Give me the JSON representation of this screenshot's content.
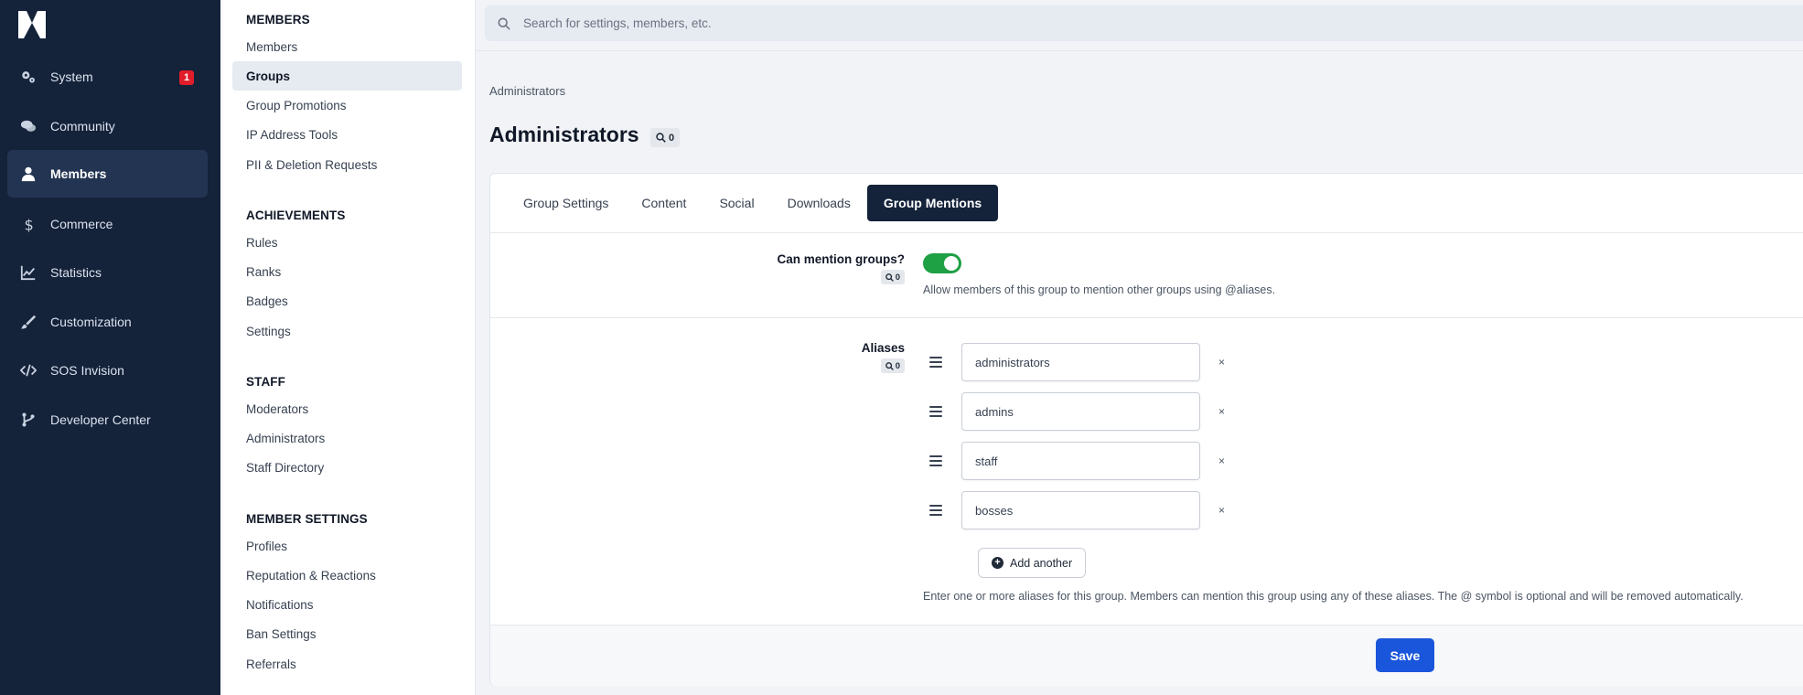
{
  "nav": {
    "logo_icon": "invision-logo",
    "items": [
      {
        "label": "System",
        "icon": "gears-icon",
        "badge": "1"
      },
      {
        "label": "Community",
        "icon": "chat-icon"
      },
      {
        "label": "Members",
        "icon": "user-icon",
        "active": true
      },
      {
        "label": "Commerce",
        "icon": "dollar-icon"
      },
      {
        "label": "Statistics",
        "icon": "chart-line-icon"
      },
      {
        "label": "Customization",
        "icon": "brush-icon"
      },
      {
        "label": "SOS Invision",
        "icon": "code-icon"
      },
      {
        "label": "Developer Center",
        "icon": "branch-icon"
      }
    ]
  },
  "submenu": {
    "sections": [
      {
        "heading": "MEMBERS",
        "items": [
          "Members",
          "Groups",
          "Group Promotions",
          "IP Address Tools",
          "PII & Deletion Requests"
        ]
      },
      {
        "heading": "ACHIEVEMENTS",
        "items": [
          "Rules",
          "Ranks",
          "Badges",
          "Settings"
        ]
      },
      {
        "heading": "STAFF",
        "items": [
          "Moderators",
          "Administrators",
          "Staff Directory"
        ]
      },
      {
        "heading": "MEMBER SETTINGS",
        "items": [
          "Profiles",
          "Reputation & Reactions",
          "Notifications",
          "Ban Settings",
          "Referrals"
        ]
      }
    ],
    "active_item": "Groups"
  },
  "search": {
    "placeholder": "Search for settings, members, etc."
  },
  "breadcrumb": "Administrators",
  "page": {
    "title": "Administrators",
    "search_count": "0"
  },
  "tabs": [
    "Group Settings",
    "Content",
    "Social",
    "Downloads",
    "Group Mentions"
  ],
  "active_tab": "Group Mentions",
  "mention_setting": {
    "label": "Can mention groups?",
    "search_count": "0",
    "enabled": true,
    "description": "Allow members of this group to mention other groups using @aliases."
  },
  "aliases": {
    "label": "Aliases",
    "search_count": "0",
    "values": [
      "administrators",
      "admins",
      "staff",
      "bosses"
    ],
    "remove_glyph": "×",
    "add_label": "Add another",
    "description": "Enter one or more aliases for this group. Members can mention this group using any of these aliases. The @ symbol is optional and will be removed automatically."
  },
  "save_label": "Save",
  "colors": {
    "nav_bg": "#14223a",
    "toggle_on": "#1ea045",
    "primary": "#1a56db",
    "badge": "#e11d2a"
  }
}
